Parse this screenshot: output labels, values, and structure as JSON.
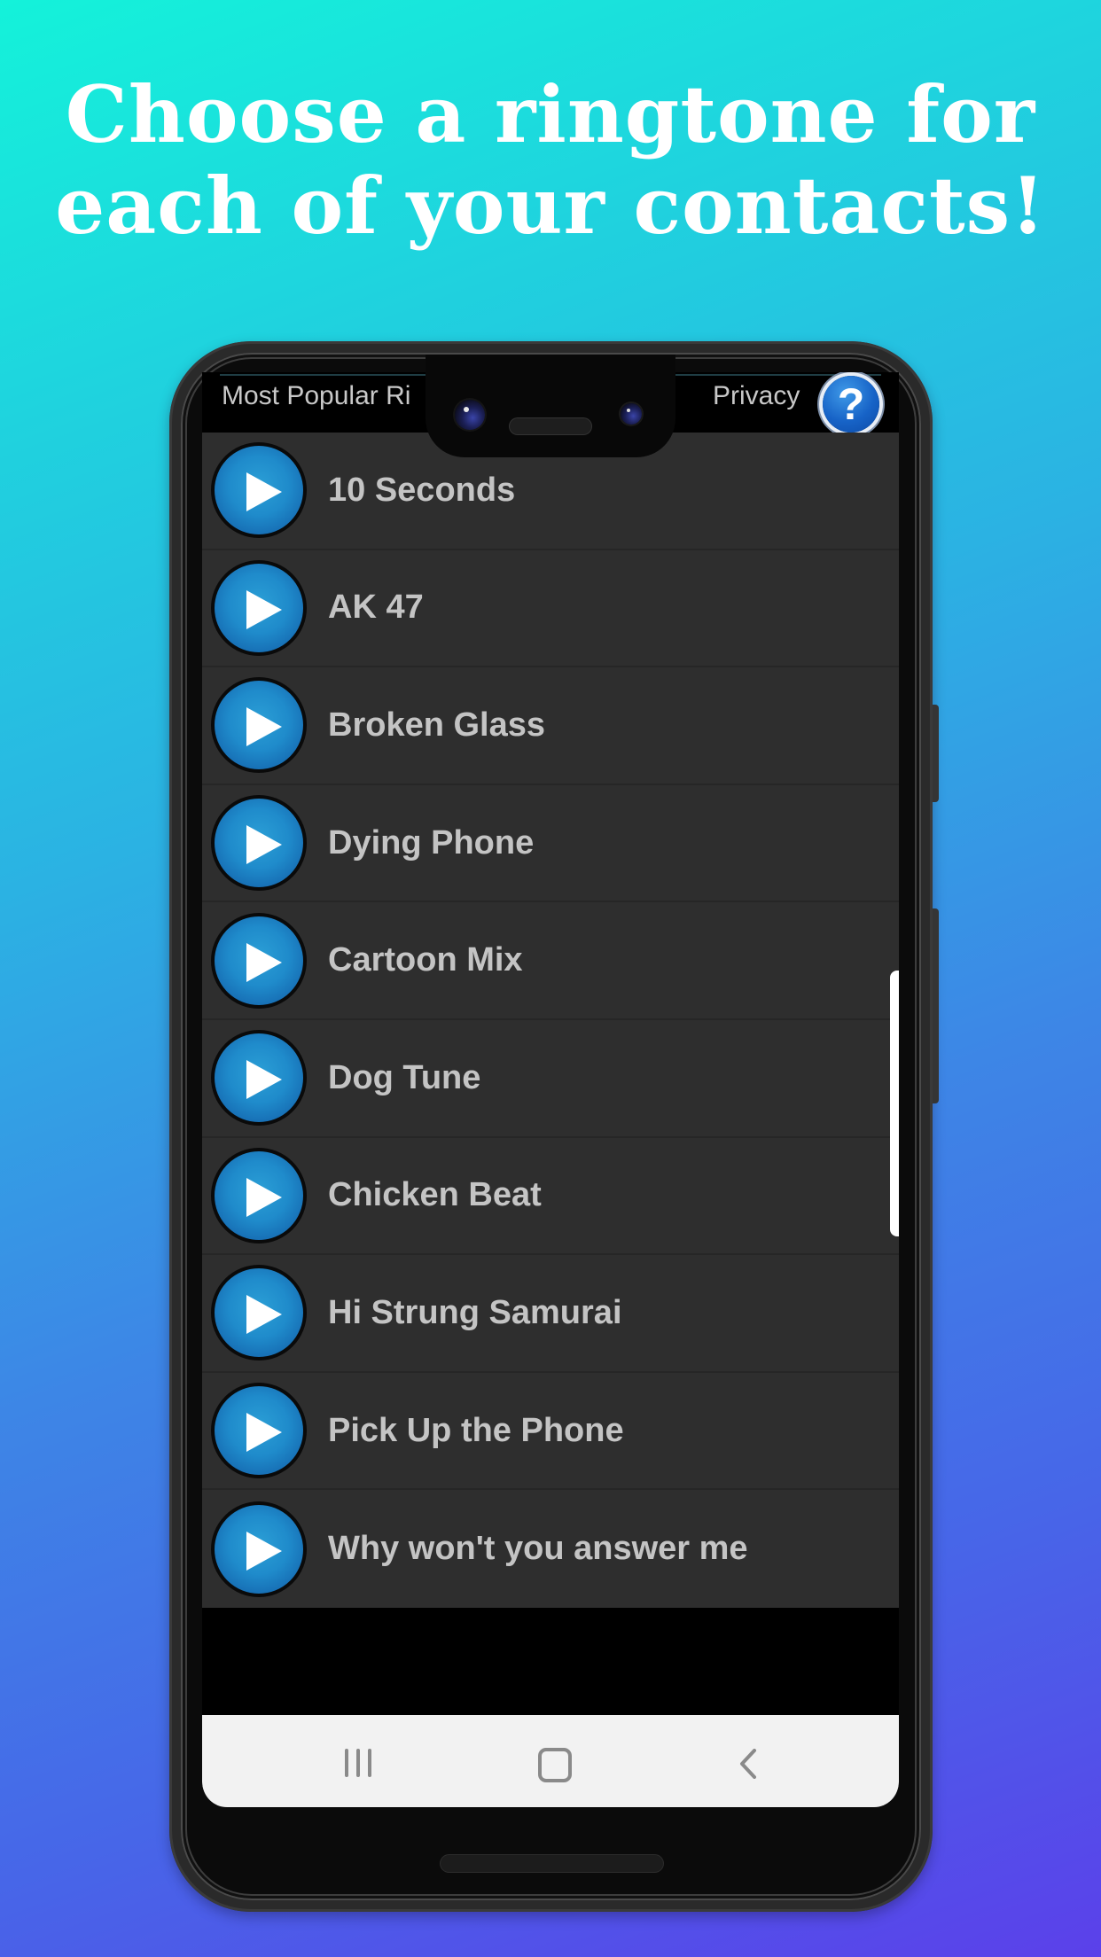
{
  "headline": {
    "line1": "Choose a ringtone for",
    "line2": "each of your contacts!"
  },
  "app_bar": {
    "title": "Most Popular Ri",
    "privacy_label": "Privacy",
    "help_label": "?",
    "help_icon": "help-question-icon"
  },
  "ringtones": [
    {
      "name": "10 Seconds",
      "icon": "play-icon"
    },
    {
      "name": "AK 47",
      "icon": "play-icon"
    },
    {
      "name": "Broken Glass",
      "icon": "play-icon"
    },
    {
      "name": "Dying Phone",
      "icon": "play-icon"
    },
    {
      "name": "Cartoon Mix",
      "icon": "play-icon"
    },
    {
      "name": "Dog Tune",
      "icon": "play-icon"
    },
    {
      "name": "Chicken Beat",
      "icon": "play-icon"
    },
    {
      "name": "Hi Strung Samurai",
      "icon": "play-icon"
    },
    {
      "name": "Pick Up the Phone",
      "icon": "play-icon"
    },
    {
      "name": "Why won't you answer me",
      "icon": "play-icon"
    }
  ],
  "nav_bar": {
    "recents_icon": "recent-apps-icon",
    "home_icon": "home-icon",
    "back_icon": "back-chevron-icon"
  },
  "colors": {
    "accent_blue": "#1f8bcb",
    "list_background": "#2e2e2e",
    "list_text": "#c4c4c4",
    "nav_background": "#f2f2f2"
  }
}
